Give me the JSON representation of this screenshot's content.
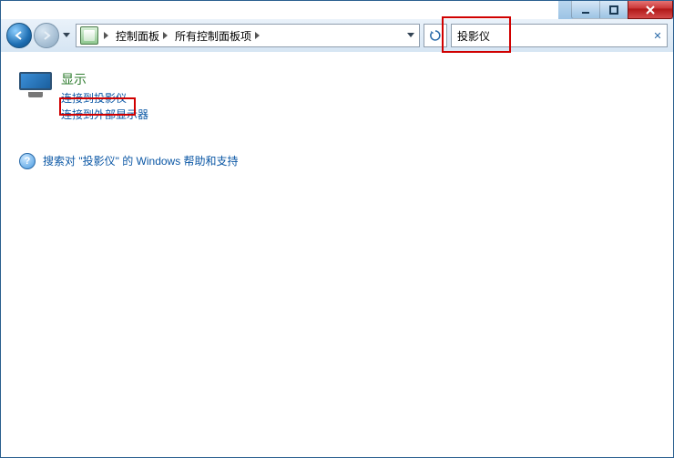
{
  "titlebar": {
    "minimize_name": "minimize",
    "maximize_name": "maximize",
    "close_name": "close"
  },
  "nav": {
    "breadcrumb": [
      {
        "label": ""
      },
      {
        "label": "控制面板"
      },
      {
        "label": "所有控制面板项"
      }
    ]
  },
  "search": {
    "value": "投影仪",
    "clear_glyph": "✕"
  },
  "results": {
    "display": {
      "heading": "显示",
      "tasks": [
        "连接到投影仪",
        "连接到外部显示器"
      ]
    }
  },
  "help": {
    "text": "搜索对 \"投影仪\" 的 Windows 帮助和支持"
  }
}
